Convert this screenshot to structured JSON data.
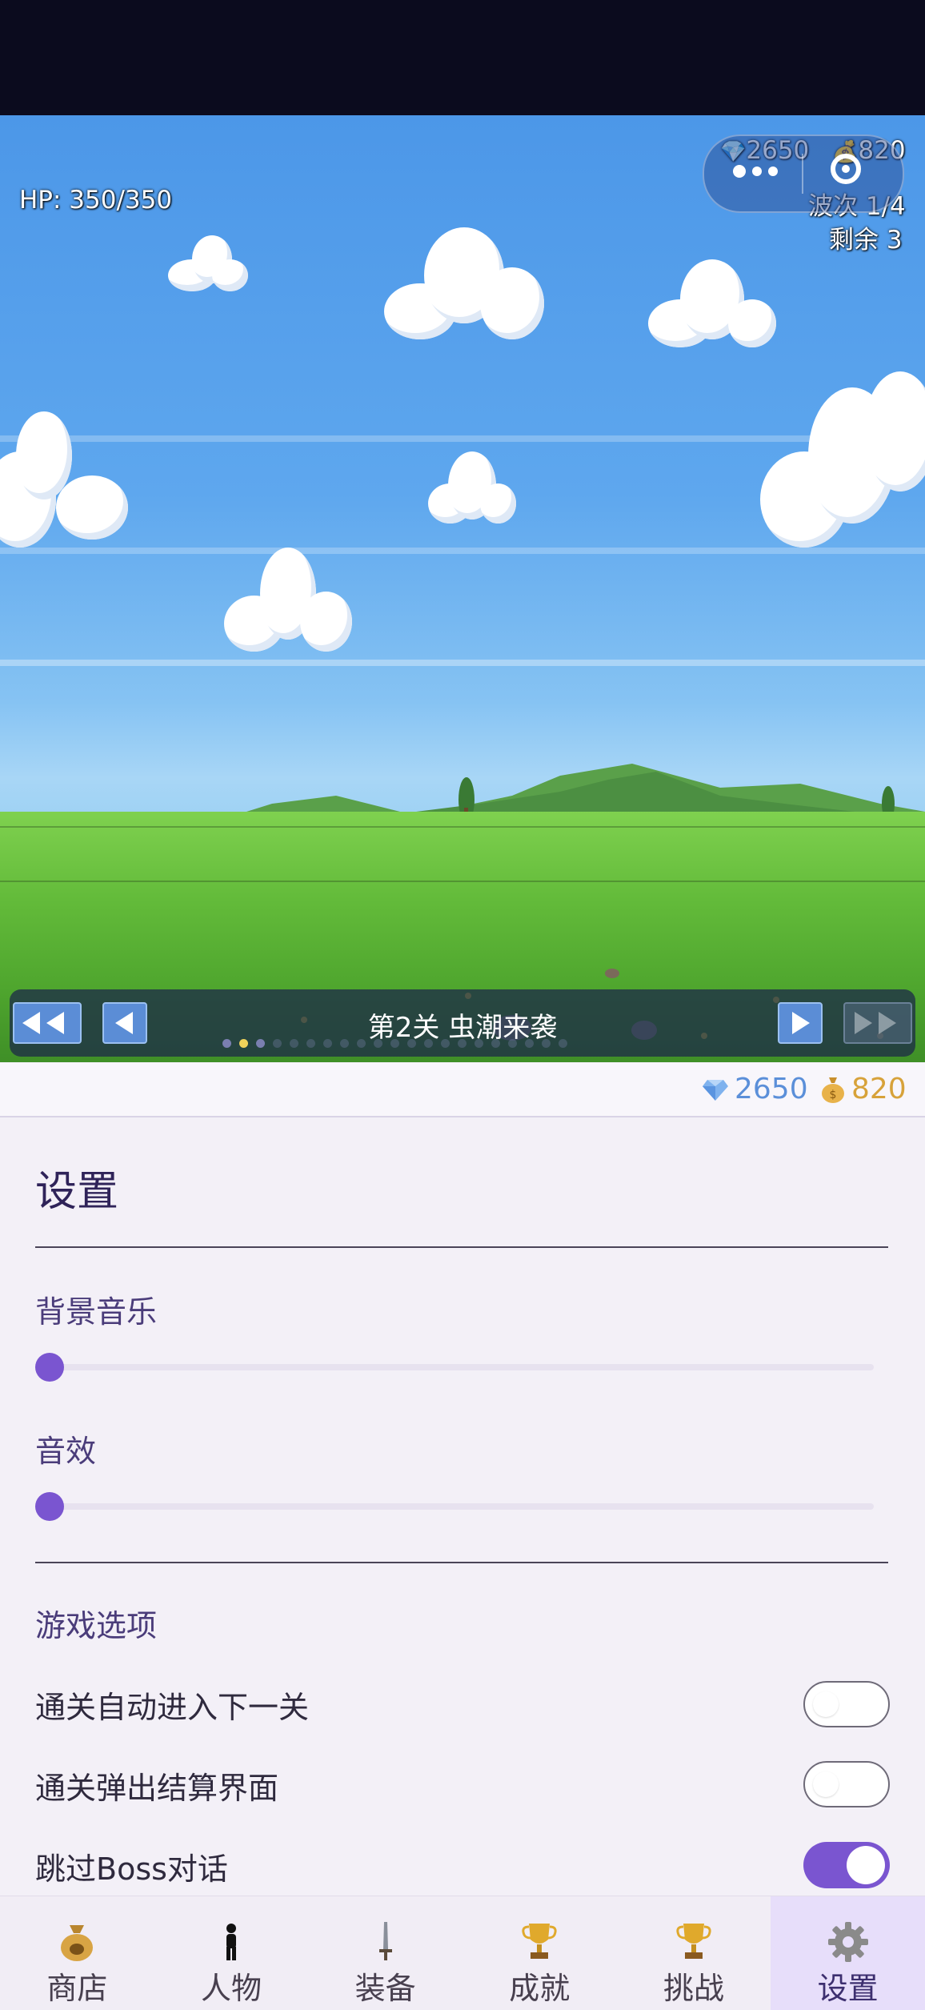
{
  "hud": {
    "hp": "HP: 350/350",
    "gems": "2650",
    "gold": "820",
    "wave": "波次 1/4",
    "remaining": "剩余 3"
  },
  "level_bar": {
    "title": "第2关  虫潮来袭",
    "active_page_index": 1
  },
  "currency": {
    "gems": "2650",
    "gold": "820",
    "gem_color": "#5b8fd9",
    "gold_color": "#d7a23a"
  },
  "settings": {
    "title": "设置",
    "bgm_label": "背景音乐",
    "bgm_value": 0,
    "sfx_label": "音效",
    "sfx_value": 0,
    "game_options_label": "游戏选项",
    "options": [
      {
        "label": "通关自动进入下一关",
        "enabled": false
      },
      {
        "label": "通关弹出结算界面",
        "enabled": false
      },
      {
        "label": "跳过Boss对话",
        "enabled": true
      }
    ],
    "accent_color": "#7a55d0"
  },
  "nav": {
    "items": [
      {
        "label": "商店",
        "icon": "money-bag-icon"
      },
      {
        "label": "人物",
        "icon": "person-icon"
      },
      {
        "label": "装备",
        "icon": "sword-icon"
      },
      {
        "label": "成就",
        "icon": "trophy-icon"
      },
      {
        "label": "挑战",
        "icon": "trophy-icon"
      },
      {
        "label": "设置",
        "icon": "gear-icon"
      }
    ],
    "active": "设置"
  }
}
